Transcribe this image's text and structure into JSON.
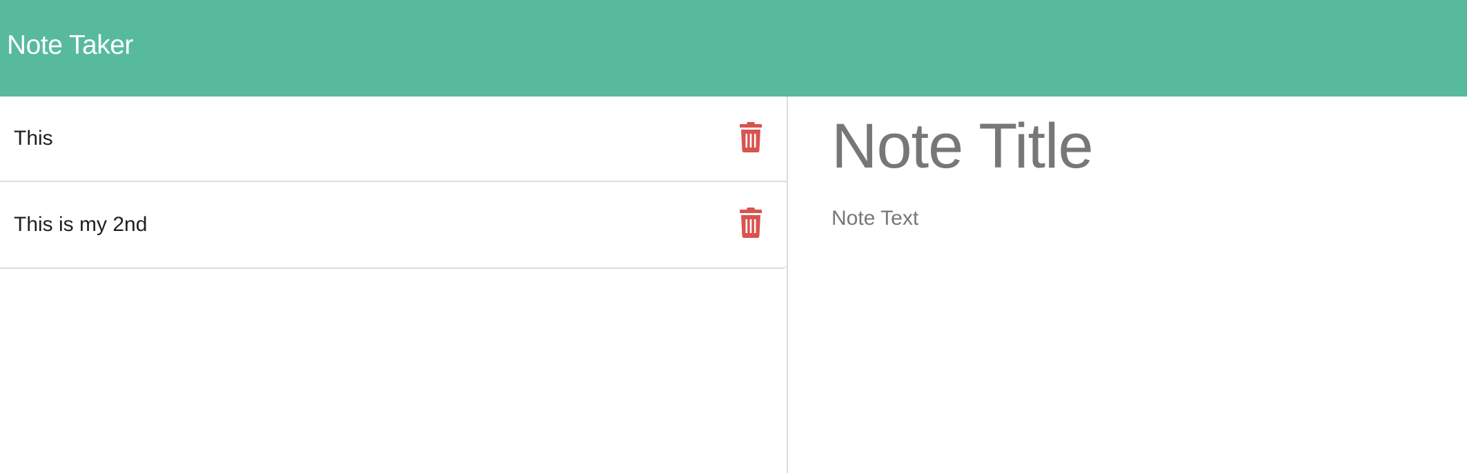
{
  "navbar": {
    "brand": "Note Taker",
    "background_color": "#57BA9D"
  },
  "notes": [
    {
      "title": "This",
      "delete_icon": "trash-icon"
    },
    {
      "title": "This is my 2nd",
      "delete_icon": "trash-icon"
    }
  ],
  "editor": {
    "title_placeholder": "Note Title",
    "text_placeholder": "Note Text"
  },
  "colors": {
    "delete": "#D9534F",
    "placeholder": "#777777",
    "border": "#DCDCDC"
  }
}
